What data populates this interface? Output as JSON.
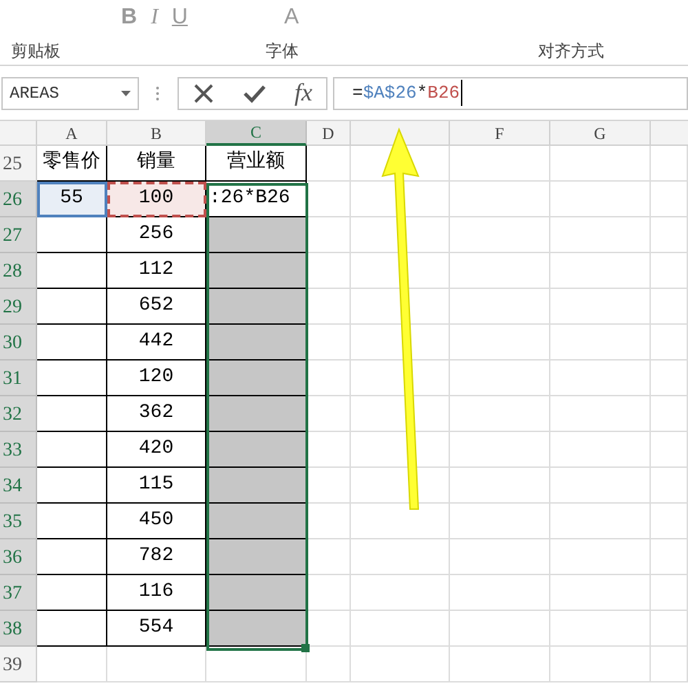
{
  "ribbon": {
    "font_buttons": [
      {
        "label": "B",
        "kind": "bold"
      },
      {
        "label": "I",
        "kind": "italic"
      },
      {
        "label": "U",
        "kind": "underline"
      },
      {
        "label": "A",
        "kind": "color"
      }
    ],
    "groups": [
      {
        "label": "剪贴板"
      },
      {
        "label": "字体"
      },
      {
        "label": "对齐方式"
      }
    ]
  },
  "name_box": "AREAS",
  "fx_label": "fx",
  "formula": [
    {
      "text": "=",
      "kind": "plain"
    },
    {
      "text": "$A$26",
      "kind": "ref",
      "color": "#4f81bd"
    },
    {
      "text": "*",
      "kind": "plain"
    },
    {
      "text": "B26",
      "kind": "ref",
      "color": "#c0504d"
    }
  ],
  "columns": [
    {
      "label": "A",
      "selected": false
    },
    {
      "label": "B",
      "selected": false
    },
    {
      "label": "C",
      "selected": true
    },
    {
      "label": "D",
      "selected": false
    },
    {
      "selected": false
    },
    {
      "label": "F",
      "selected": false
    },
    {
      "label": "G",
      "selected": false
    }
  ],
  "rows": [
    {
      "header": "25",
      "selected": false,
      "cells": [
        {
          "text": "零售价",
          "selected": false
        },
        {
          "text": "销量",
          "selected": false
        },
        {
          "text": "营业额",
          "selected": false
        }
      ]
    },
    {
      "header": "26",
      "selected": true,
      "cells": [
        {
          "text": "55",
          "selected": false,
          "color": "#4f81bd"
        },
        {
          "text": "100",
          "selected": false,
          "color": "#c0504d"
        },
        {
          "text": ":26*B26",
          "selected": false
        }
      ]
    },
    {
      "header": "27",
      "selected": true,
      "cells": [
        {
          "text": "",
          "selected": false
        },
        {
          "text": "256",
          "selected": false
        },
        {
          "text": "",
          "selected": true
        }
      ]
    },
    {
      "header": "28",
      "selected": true,
      "cells": [
        {
          "text": "",
          "selected": false
        },
        {
          "text": "112",
          "selected": false
        },
        {
          "text": "",
          "selected": true
        }
      ]
    },
    {
      "header": "29",
      "selected": true,
      "cells": [
        {
          "text": "",
          "selected": false
        },
        {
          "text": "652",
          "selected": false
        },
        {
          "text": "",
          "selected": true
        }
      ]
    },
    {
      "header": "30",
      "selected": true,
      "cells": [
        {
          "text": "",
          "selected": false
        },
        {
          "text": "442",
          "selected": false
        },
        {
          "text": "",
          "selected": true
        }
      ]
    },
    {
      "header": "31",
      "selected": true,
      "cells": [
        {
          "text": "",
          "selected": false
        },
        {
          "text": "120",
          "selected": false
        },
        {
          "text": "",
          "selected": true
        }
      ]
    },
    {
      "header": "32",
      "selected": true,
      "cells": [
        {
          "text": "",
          "selected": false
        },
        {
          "text": "362",
          "selected": false
        },
        {
          "text": "",
          "selected": true
        }
      ]
    },
    {
      "header": "33",
      "selected": true,
      "cells": [
        {
          "text": "",
          "selected": false
        },
        {
          "text": "420",
          "selected": false
        },
        {
          "text": "",
          "selected": true
        }
      ]
    },
    {
      "header": "34",
      "selected": true,
      "cells": [
        {
          "text": "",
          "selected": false
        },
        {
          "text": "115",
          "selected": false
        },
        {
          "text": "",
          "selected": true
        }
      ]
    },
    {
      "header": "35",
      "selected": true,
      "cells": [
        {
          "text": "",
          "selected": false
        },
        {
          "text": "450",
          "selected": false
        },
        {
          "text": "",
          "selected": true
        }
      ]
    },
    {
      "header": "36",
      "selected": true,
      "cells": [
        {
          "text": "",
          "selected": false
        },
        {
          "text": "782",
          "selected": false
        },
        {
          "text": "",
          "selected": true
        }
      ]
    },
    {
      "header": "37",
      "selected": true,
      "cells": [
        {
          "text": "",
          "selected": false
        },
        {
          "text": "116",
          "selected": false
        },
        {
          "text": "",
          "selected": true
        }
      ]
    },
    {
      "header": "38",
      "selected": true,
      "cells": [
        {
          "text": "",
          "selected": false
        },
        {
          "text": "554",
          "selected": false
        },
        {
          "text": "",
          "selected": true
        }
      ]
    },
    {
      "header": "39",
      "selected": false,
      "cells": []
    }
  ]
}
